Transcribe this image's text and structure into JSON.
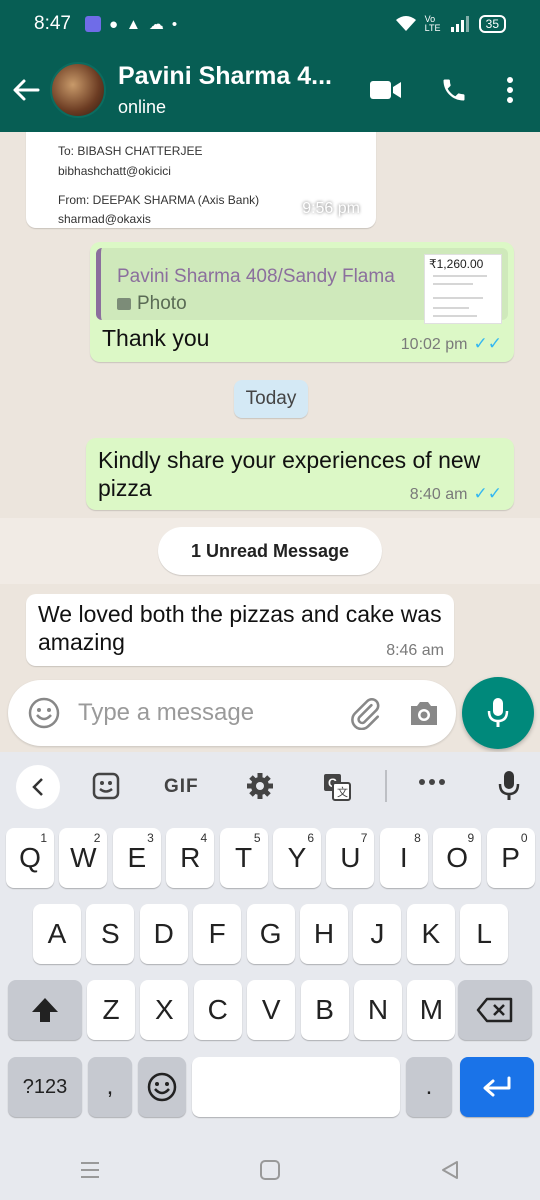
{
  "status_bar": {
    "time": "8:47",
    "battery": "35",
    "network": "Vo LTE"
  },
  "header": {
    "name": "Pavini Sharma 4...",
    "status": "online"
  },
  "receipt": {
    "to_line": "To: BIBASH CHATTERJEE",
    "to_id": "bibhashchatt@okicici",
    "from_line": "From: DEEPAK SHARMA (Axis Bank)",
    "from_id": "sharmad@okaxis",
    "time": "9:56 pm"
  },
  "reply_message": {
    "quote_name": "Pavini Sharma 408/Sandy Flama",
    "quote_type": "Photo",
    "thumb_amount": "₹1,260.00",
    "text": "Thank you",
    "time": "10:02 pm"
  },
  "date_chip": "Today",
  "message_pizza": {
    "text": "Kindly share your experiences of new pizza",
    "time": "8:40 am"
  },
  "unread": "1 Unread Message",
  "message_reply": {
    "text": "We loved both the pizzas and cake was amazing",
    "time": "8:46 am"
  },
  "input": {
    "placeholder": "Type a message"
  },
  "keyboard": {
    "gif": "GIF",
    "row1": [
      {
        "k": "Q",
        "h": "1"
      },
      {
        "k": "W",
        "h": "2"
      },
      {
        "k": "E",
        "h": "3"
      },
      {
        "k": "R",
        "h": "4"
      },
      {
        "k": "T",
        "h": "5"
      },
      {
        "k": "Y",
        "h": "6"
      },
      {
        "k": "U",
        "h": "7"
      },
      {
        "k": "I",
        "h": "8"
      },
      {
        "k": "O",
        "h": "9"
      },
      {
        "k": "P",
        "h": "0"
      }
    ],
    "row2": [
      "A",
      "S",
      "D",
      "F",
      "G",
      "H",
      "J",
      "K",
      "L"
    ],
    "row3": [
      "Z",
      "X",
      "C",
      "V",
      "B",
      "N",
      "M"
    ],
    "numbers_key": "?123",
    "comma": ",",
    "period": "."
  },
  "colors": {
    "header": "#075e54",
    "outgoing": "#dcf8c6",
    "incoming": "#ffffff",
    "fab": "#00897b",
    "ticks": "#34b7f1"
  }
}
